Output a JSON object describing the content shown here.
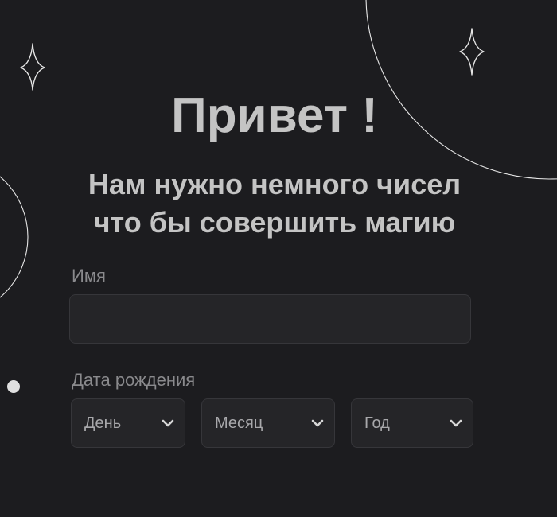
{
  "header": {
    "title": "Привет !",
    "subtitle_line1": "Нам нужно немного чисел",
    "subtitle_line2": "что бы совершить магию"
  },
  "form": {
    "name_label": "Имя",
    "name_value": "",
    "name_placeholder": "",
    "dob_label": "Дата рождения",
    "day_select": {
      "selected": "День",
      "icon": "chevron-down-icon"
    },
    "month_select": {
      "selected": "Месяц",
      "icon": "chevron-down-icon"
    },
    "year_select": {
      "selected": "Год",
      "icon": "chevron-down-icon"
    }
  },
  "decorations": {
    "icons": [
      "sparkle-icon",
      "sparkle-icon",
      "dot-icon"
    ],
    "line_color": "#e6e6e6",
    "dot_color": "#e0e0e0"
  },
  "colors": {
    "background": "#1c1c1f",
    "field_background": "#252528",
    "field_border": "#36363a",
    "text_primary": "#c4c4c4",
    "text_muted": "#8a8a8d"
  }
}
